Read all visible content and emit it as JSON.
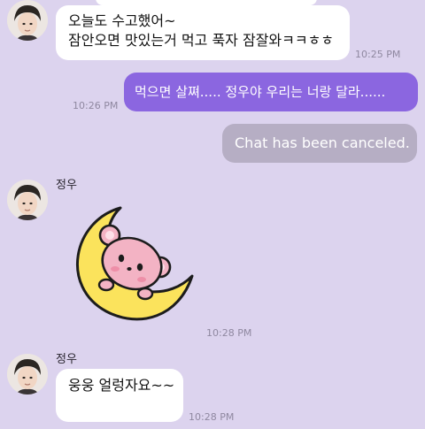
{
  "messages": {
    "m1": {
      "line1": "오늘도 수고했어~",
      "line2": "잠안오면 맛있는거 먹고 푹자 잠잘와ㅋㅋㅎㅎ",
      "time": "10:25 PM"
    },
    "m2": {
      "text": "먹으면 살쪄..... 정우야 우리는 너랑 달라......",
      "time": "10:26 PM"
    },
    "m3": {
      "text": "Chat has been canceled."
    },
    "m4": {
      "sender": "정우",
      "sticker_icon": "moon-bear-sticker",
      "time": "10:28 PM"
    },
    "m5": {
      "sender": "정우",
      "text": "웅웅 얼렁자요~~",
      "time": "10:28 PM"
    }
  },
  "colors": {
    "background": "#dcd3ee",
    "incoming_bubble": "#ffffff",
    "outgoing_bubble": "#8b66e0",
    "canceled_bubble": "#b6aec4"
  }
}
